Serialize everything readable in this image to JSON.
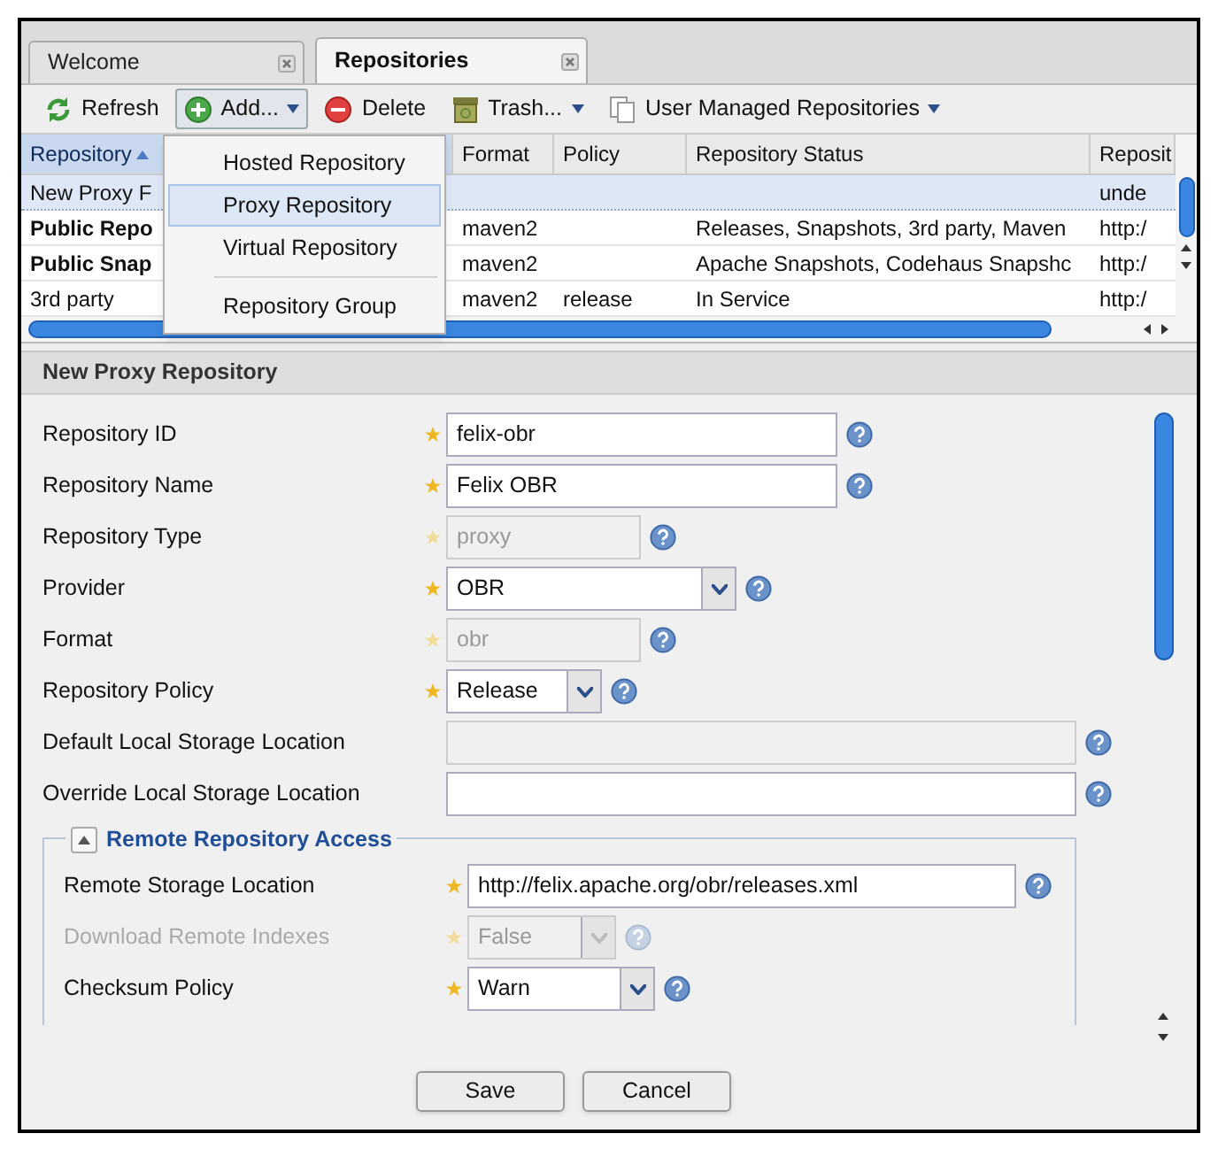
{
  "tabs": [
    {
      "label": "Welcome",
      "selected": false
    },
    {
      "label": "Repositories",
      "selected": true
    }
  ],
  "toolbar": [
    {
      "kind": "refresh",
      "label": "Refresh",
      "pressed": false,
      "dropdown": false
    },
    {
      "kind": "add",
      "label": "Add...",
      "pressed": true,
      "dropdown": true
    },
    {
      "kind": "delete",
      "label": "Delete",
      "pressed": false,
      "dropdown": false
    },
    {
      "kind": "trash",
      "label": "Trash...",
      "pressed": false,
      "dropdown": true
    },
    {
      "kind": "copy",
      "label": "User Managed Repositories",
      "pressed": false,
      "dropdown": true
    }
  ],
  "table": {
    "columns": [
      {
        "label": "Repository",
        "sorted": true
      },
      {
        "label": "Format",
        "sorted": false
      },
      {
        "label": "Policy",
        "sorted": false
      },
      {
        "label": "Repository Status",
        "sorted": false
      },
      {
        "label": "Reposit",
        "sorted": false
      }
    ],
    "rows": [
      {
        "selected": true,
        "bold": false,
        "cells": [
          "New Proxy F",
          "",
          "",
          "",
          "unde"
        ]
      },
      {
        "selected": false,
        "bold": true,
        "cells": [
          "Public Repo",
          "maven2",
          "",
          "Releases, Snapshots, 3rd party, Maven",
          "http:/"
        ]
      },
      {
        "selected": false,
        "bold": true,
        "cells": [
          "Public Snap",
          "maven2",
          "",
          "Apache Snapshots, Codehaus Snapshc",
          "http:/"
        ]
      },
      {
        "selected": false,
        "bold": false,
        "cells": [
          "3rd party",
          "maven2",
          "release",
          "In Service",
          "http:/"
        ]
      }
    ]
  },
  "add_menu": [
    {
      "kind": "item",
      "label": "Hosted Repository",
      "selected": false
    },
    {
      "kind": "item",
      "label": "Proxy Repository",
      "selected": true
    },
    {
      "kind": "item",
      "label": "Virtual Repository",
      "selected": false
    },
    {
      "kind": "separator"
    },
    {
      "kind": "item",
      "label": "Repository Group",
      "selected": false
    }
  ],
  "form": {
    "title": "New Proxy Repository",
    "fields": [
      {
        "label": "Repository ID",
        "required": true,
        "kind": "text",
        "value": "felix-obr",
        "disabled": false
      },
      {
        "label": "Repository Name",
        "required": true,
        "kind": "text",
        "value": "Felix OBR",
        "disabled": false
      },
      {
        "label": "Repository Type",
        "required": true,
        "kind": "text",
        "value": "proxy",
        "disabled": true
      },
      {
        "label": "Provider",
        "required": true,
        "kind": "select",
        "value": "OBR",
        "disabled": false
      },
      {
        "label": "Format",
        "required": true,
        "kind": "text",
        "value": "obr",
        "disabled": true
      },
      {
        "label": "Repository Policy",
        "required": true,
        "kind": "select",
        "value": "Release",
        "disabled": false
      },
      {
        "label": "Default Local Storage Location",
        "required": false,
        "kind": "text",
        "disabled": true
      },
      {
        "label": "Override Local Storage Location",
        "required": false,
        "kind": "text",
        "disabled": false
      }
    ],
    "section": {
      "title": "Remote Repository Access",
      "expanded": true,
      "fields": [
        {
          "label": "Remote Storage Location",
          "required": true,
          "kind": "text",
          "value": "http://felix.apache.org/obr/releases.xml",
          "disabled": false
        },
        {
          "label": "Download Remote Indexes",
          "required": true,
          "kind": "select",
          "value": "False",
          "disabled": true
        },
        {
          "label": "Checksum Policy",
          "required": true,
          "kind": "select",
          "value": "Warn",
          "disabled": false
        }
      ]
    },
    "buttons": [
      "Save",
      "Cancel"
    ]
  }
}
